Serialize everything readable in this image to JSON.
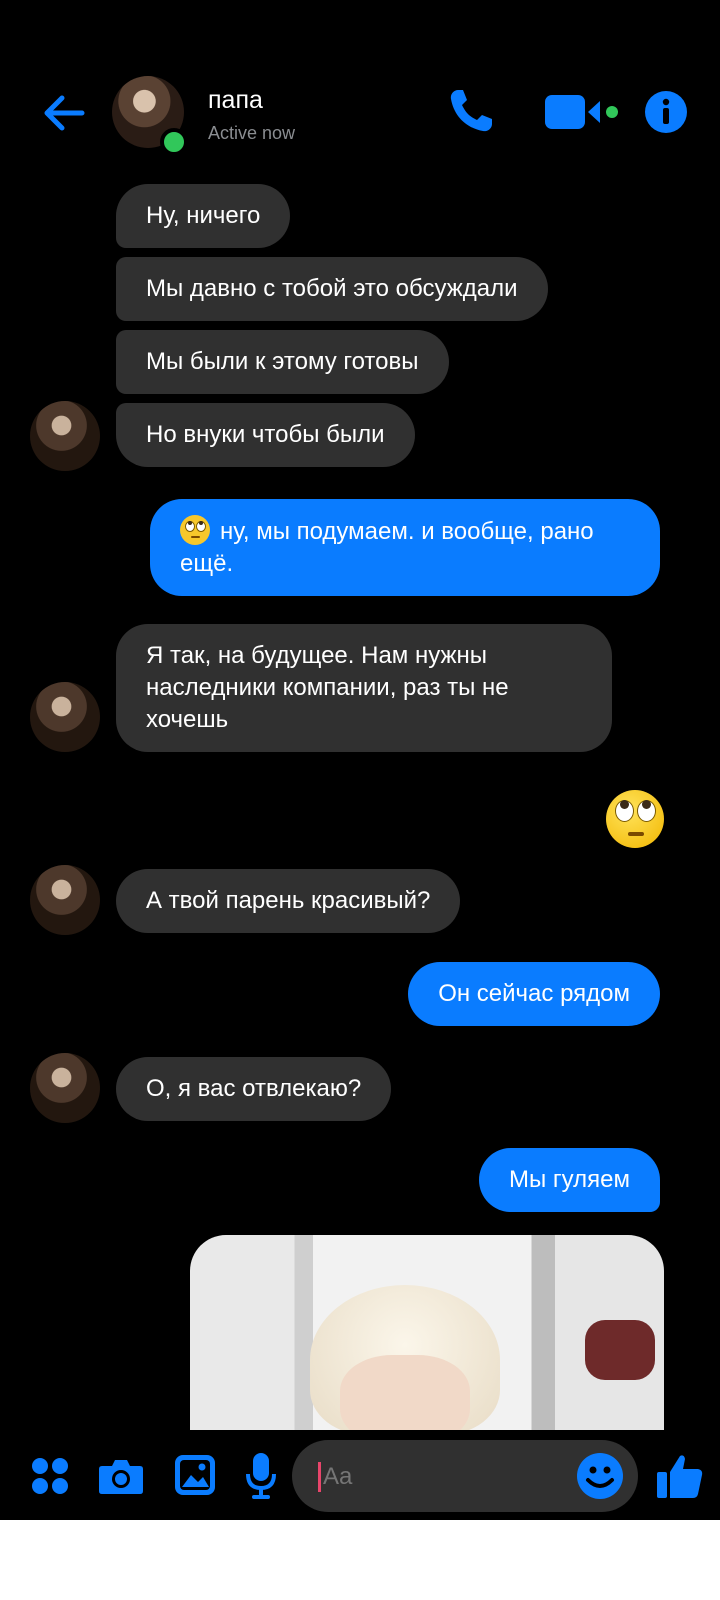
{
  "contact": {
    "name": "папа",
    "status": "Active now"
  },
  "colors": {
    "accent": "#0a7cff",
    "incoming_bubble": "#303030",
    "online": "#31c75a"
  },
  "header_icons": [
    "back-arrow-icon",
    "phone-icon",
    "video-camera-icon",
    "info-icon"
  ],
  "messages": [
    {
      "from": "them",
      "text": "Ну, ничего"
    },
    {
      "from": "them",
      "text": "Мы давно с тобой это обсуждали"
    },
    {
      "from": "them",
      "text": "Мы были к этому готовы"
    },
    {
      "from": "them",
      "text": "Но внуки чтобы были"
    },
    {
      "from": "me",
      "emoji": "face-with-rolling-eyes",
      "text": "ну, мы подумаем. и вообще, рано ещё."
    },
    {
      "from": "them",
      "text": "Я так, на будущее. Нам нужны наследники компании, раз ты не хочешь"
    },
    {
      "from": "me",
      "emoji_only": "face-with-rolling-eyes"
    },
    {
      "from": "them",
      "text": "А твой парень красивый?"
    },
    {
      "from": "me",
      "text": "Он сейчас рядом"
    },
    {
      "from": "them",
      "text": "О, я вас отвлекаю?"
    },
    {
      "from": "me",
      "text": "Мы гуляем"
    },
    {
      "from": "me",
      "attachment": "photo"
    }
  ],
  "composer": {
    "placeholder": "Aa"
  },
  "toolbar_icons": [
    "menu-dots-icon",
    "camera-icon",
    "gallery-icon",
    "microphone-icon",
    "emoji-icon",
    "thumbs-up-icon"
  ]
}
